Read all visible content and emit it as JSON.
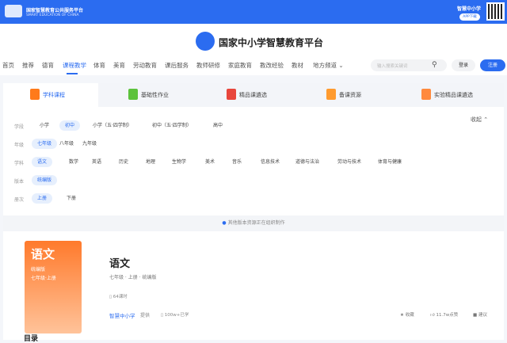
{
  "topbar": {
    "title": "国家智慧教育公共服务平台",
    "subtitle": "SMART EDUCATION OF CHINA",
    "app_name": "智慧中小学",
    "app_button": "APP下载"
  },
  "header": {
    "site_title": "国家中小学智慧教育平台"
  },
  "nav": {
    "items": [
      "首页",
      "推荐",
      "德育",
      "课程教学",
      "体育",
      "美育",
      "劳动教育",
      "课后服务",
      "教师研修",
      "家庭教育",
      "教改经验",
      "教材",
      "地方频道 ⌄"
    ],
    "active": 3,
    "search_placeholder": "输入搜索关键词",
    "login": "登录",
    "register": "注册"
  },
  "tabs": [
    {
      "label": "学科课程",
      "color": "#ff7a1a"
    },
    {
      "label": "基础性作业",
      "color": "#5cc23c"
    },
    {
      "label": "精品课遴选",
      "color": "#e8463c"
    },
    {
      "label": "备课资源",
      "color": "#ff9b2f"
    },
    {
      "label": "实验精品课遴选",
      "color": "#ff8a3d"
    }
  ],
  "filters": [
    {
      "label": "学段",
      "options": [
        "小学",
        "初中",
        "小学（五·四学制）",
        "初中（五·四学制）",
        "高中"
      ],
      "selected": 1
    },
    {
      "label": "年级",
      "options": [
        "七年级",
        "八年级",
        "九年级"
      ],
      "selected": 0
    },
    {
      "label": "学科",
      "options": [
        "语文",
        "数学",
        "英语",
        "历史",
        "地理",
        "生物学",
        "美术",
        "音乐",
        "信息技术",
        "道德与法治",
        "劳动与技术",
        "体育与健康"
      ],
      "selected": 0
    },
    {
      "label": "版本",
      "options": [
        "统编版"
      ],
      "selected": 0
    },
    {
      "label": "册次",
      "options": [
        "上册",
        "下册"
      ],
      "selected": 0
    }
  ],
  "collapse": "收起 ⌃",
  "notice": "其他版本资源正在组织制作",
  "course": {
    "cover_title": "语文",
    "cover_edition": "统编版",
    "cover_grade": "七年级·上册",
    "title": "语文",
    "subtitle": "七年级 · 上册 · 统编版",
    "lessons": "64课时",
    "provider": "智慧中小学",
    "provided": "提供",
    "learned": "100w+已学",
    "favorite": "收藏",
    "likes": "11.7w点赞",
    "suggest": "建议"
  },
  "toc": "目录"
}
